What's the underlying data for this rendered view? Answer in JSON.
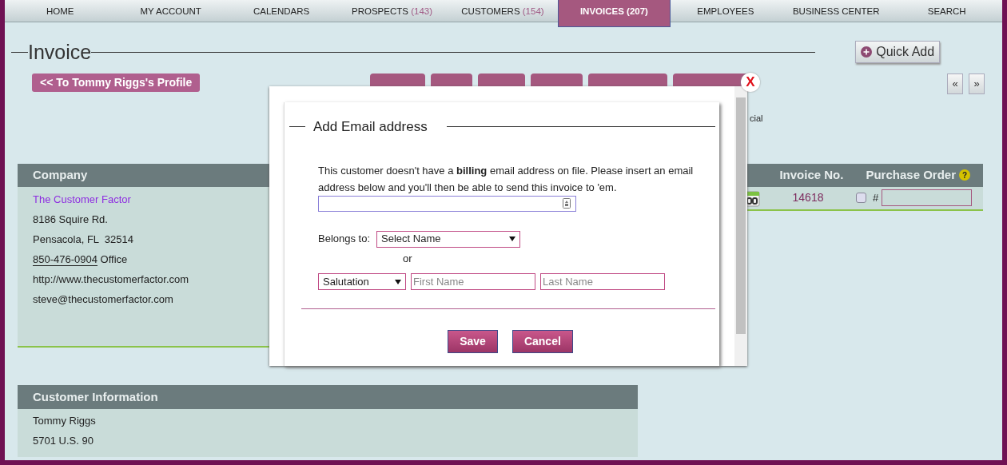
{
  "nav": [
    {
      "label": "HOME",
      "selected": false
    },
    {
      "label": "MY ACCOUNT",
      "selected": false
    },
    {
      "label": "CALENDARS",
      "selected": false
    },
    {
      "label": "PROSPECTS",
      "count": "(143)",
      "selected": false
    },
    {
      "label": "CUSTOMERS",
      "count": "(154)",
      "selected": false
    },
    {
      "label": "INVOICES",
      "count": "(207)",
      "selected": true
    },
    {
      "label": "EMPLOYEES",
      "selected": false
    },
    {
      "label": "BUSINESS CENTER",
      "selected": false
    },
    {
      "label": "SEARCH",
      "selected": false
    }
  ],
  "page_title": "Invoice",
  "quick_add": "Quick Add",
  "profile_button": "<< To Tommy Riggs's Profile",
  "pager": [
    "«",
    "»"
  ],
  "partial_text": "cial",
  "company": {
    "heading": "Company",
    "name": "The Customer Factor",
    "address_line_1": "8186 Squire Rd.",
    "address_line_2": "Pensacola, FL  32514",
    "phone": "850-476-0904",
    "phone_label": "Office",
    "website": "http://www.thecustomerfactor.com",
    "email": "steve@thecustomerfactor.com"
  },
  "invoice_table": {
    "columns": [
      "Invoice No.",
      "Purchase Order"
    ],
    "help": "?",
    "invoice_no": "14618",
    "po_checked": false,
    "po_hash": "#"
  },
  "customer_info": {
    "heading": "Customer Information",
    "lines": [
      "Tommy Riggs",
      "5701 U.S. 90"
    ]
  },
  "modal": {
    "close": "X",
    "title": "Add Email address",
    "message": "This customer doesn't have a **billing** email address on file. Please insert an email address below and you'll then be able to send this invoice to 'em.",
    "belongs_label": "Belongs to:",
    "belongs_select": "Select Name",
    "or_text": "or",
    "salutation": "Salutation",
    "first_name_placeholder": "First Name",
    "last_name_placeholder": "Last Name",
    "buttons": [
      "Save",
      "Cancel"
    ]
  }
}
